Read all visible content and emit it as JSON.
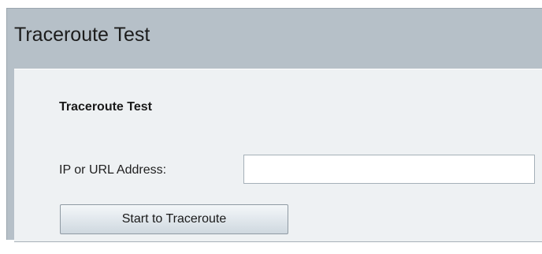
{
  "page": {
    "title": "Traceroute Test"
  },
  "panel": {
    "heading": "Traceroute Test",
    "address_label": "IP or URL Address:",
    "address_value": "",
    "button_label": "Start to Traceroute"
  }
}
